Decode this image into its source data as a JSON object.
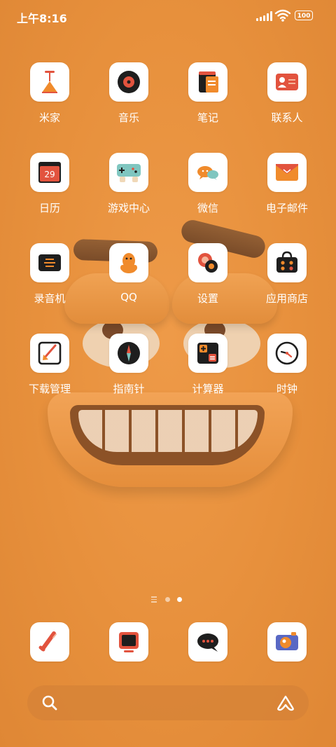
{
  "status_bar": {
    "time": "上午8:16",
    "battery_level": "100",
    "signal_icon": "cellular-signal-icon",
    "wifi_icon": "wifi-icon"
  },
  "apps": [
    {
      "label": "米家",
      "icon": "mi-home-icon"
    },
    {
      "label": "音乐",
      "icon": "music-icon"
    },
    {
      "label": "笔记",
      "icon": "notes-icon"
    },
    {
      "label": "联系人",
      "icon": "contacts-icon"
    },
    {
      "label": "日历",
      "icon": "calendar-icon",
      "calendar_day": "29"
    },
    {
      "label": "游戏中心",
      "icon": "gamepad-icon"
    },
    {
      "label": "微信",
      "icon": "wechat-icon"
    },
    {
      "label": "电子邮件",
      "icon": "email-icon"
    },
    {
      "label": "录音机",
      "icon": "recorder-icon"
    },
    {
      "label": "QQ",
      "icon": "qq-penguin-icon"
    },
    {
      "label": "设置",
      "icon": "settings-icon"
    },
    {
      "label": "应用商店",
      "icon": "app-store-bag-icon"
    },
    {
      "label": "下载管理",
      "icon": "download-manager-icon"
    },
    {
      "label": "指南针",
      "icon": "compass-icon"
    },
    {
      "label": "计算器",
      "icon": "calculator-icon"
    },
    {
      "label": "时钟",
      "icon": "clock-icon"
    }
  ],
  "page_indicator": {
    "pages": 3,
    "active_page": 3
  },
  "dock": [
    {
      "icon": "phone-icon"
    },
    {
      "icon": "browser-icon"
    },
    {
      "icon": "messages-icon"
    },
    {
      "icon": "camera-icon"
    }
  ],
  "search_bar": {
    "placeholder": "",
    "search_icon": "search-icon",
    "assistant_icon": "assistant-icon"
  },
  "colors": {
    "wallpaper": "#e8923e",
    "accent_red": "#e2533e",
    "accent_orange": "#f08b2c",
    "dark": "#1e1e1e",
    "tile": "#ffffff"
  }
}
